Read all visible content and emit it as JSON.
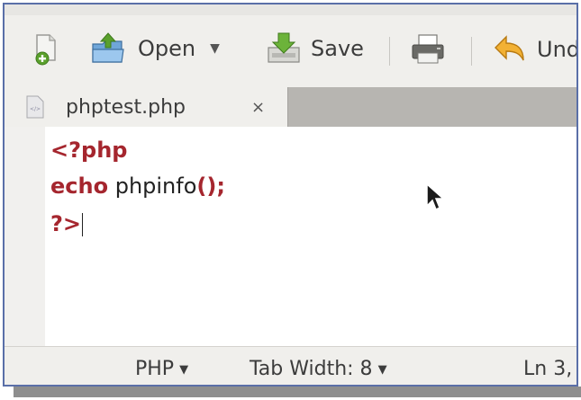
{
  "toolbar": {
    "new_icon": "new-document-icon",
    "open_label": "Open",
    "save_label": "Save",
    "print_icon": "printer-icon",
    "undo_label": "Und"
  },
  "tabs": [
    {
      "label": "phptest.php",
      "close": "×"
    }
  ],
  "editor": {
    "lines": [
      [
        {
          "text": "<?php",
          "kind": "keyword"
        }
      ],
      [
        {
          "text": "echo",
          "kind": "keyword"
        },
        {
          "text": " phpinfo",
          "kind": "plain"
        },
        {
          "text": "();",
          "kind": "keyword"
        }
      ],
      [
        {
          "text": "?>",
          "kind": "keyword"
        }
      ]
    ]
  },
  "statusbar": {
    "language": "PHP",
    "tab_width": "Tab Width: 8",
    "position": "Ln 3,"
  },
  "colors": {
    "keyword": "#a5262e",
    "frame": "#5a6fa8"
  }
}
